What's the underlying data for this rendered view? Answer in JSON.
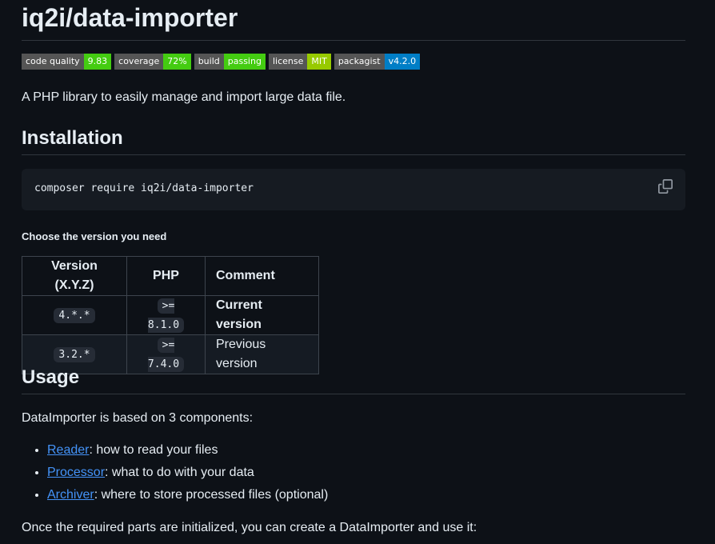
{
  "title": "iq2i/data-importer",
  "badges": [
    {
      "label": "code quality",
      "value": "9.83",
      "color": "#4c1"
    },
    {
      "label": "coverage",
      "value": "72%",
      "color": "#4c1"
    },
    {
      "label": "build",
      "value": "passing",
      "color": "#4c1"
    },
    {
      "label": "license",
      "value": "MIT",
      "color": "#97ca00"
    },
    {
      "label": "packagist",
      "value": "v4.2.0",
      "color": "#007ec6"
    }
  ],
  "intro": "A PHP library to easily manage and import large data file.",
  "installation": {
    "heading": "Installation",
    "code": "composer require iq2i/data-importer",
    "copy_icon": "copy-icon"
  },
  "versions": {
    "caption": "Choose the version you need",
    "headers": [
      "Version (X.Y.Z)",
      "PHP",
      "Comment"
    ],
    "rows": [
      {
        "version": "4.*.*",
        "php": ">= 8.1.0",
        "comment": "Current version"
      },
      {
        "version": "3.2.*",
        "php": ">= 7.4.0",
        "comment": "Previous version"
      }
    ]
  },
  "usage": {
    "heading": "Usage",
    "based_on": "DataImporter is based on 3 components:",
    "components": [
      {
        "link": "Reader",
        "text": ": how to read your files"
      },
      {
        "link": "Processor",
        "text": ": what to do with your data"
      },
      {
        "link": "Archiver",
        "text": ": where to store processed files (optional)"
      }
    ],
    "outro": "Once the required parts are initialized, you can create a DataImporter and use it:"
  },
  "colors": {
    "background": "#0d1117",
    "text": "#e6edf3",
    "link": "#4493f8",
    "border": "#30363d"
  }
}
